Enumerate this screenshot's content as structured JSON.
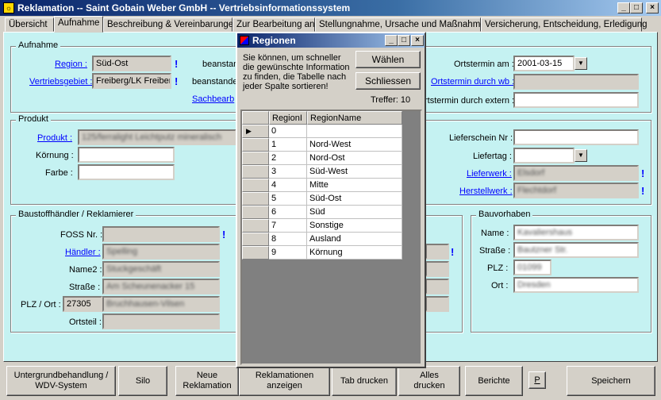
{
  "window": {
    "title": "Reklamation  --  Saint Gobain Weber GmbH -- Vertriebsinformationssystem",
    "icon": "app-icon"
  },
  "tabs": [
    "Übersicht",
    "Aufnahme",
    "Beschreibung & Vereinbarungen",
    "Zur Bearbeitung an",
    "Stellungnahme, Ursache und Maßnahmen",
    "Versicherung, Entscheidung, Erledigung"
  ],
  "aufnahme": {
    "title": "Aufnahme",
    "region_label": "Region :",
    "region_value": "Süd-Ost",
    "vertriebsgebiet_label": "Vertriebsgebiet :",
    "vertriebsgebiet_value": "Freiberg/LK Freiber",
    "beanstandet1_label": "beanstan",
    "beanstandet2_label": "beanstande",
    "sachbearbeiter_label": "Sachbearb",
    "ortstermin_label": "Ortstermin am :",
    "ortstermin_value": "2001-03-15",
    "ortstermin_wb_label": "Ortstermin durch wb :",
    "ortstermin_extern_label": "rtstermin durch extern :"
  },
  "produkt": {
    "title": "Produkt",
    "produkt_label": "Produkt :",
    "produkt_value": "125/ferralight Leichtputz mineralisch",
    "koernung_label": "Körnung :",
    "farbe_label": "Farbe :",
    "lieferschein_label": "Lieferschein Nr :",
    "liefertag_label": "Liefertag :",
    "lieferwerk_label": "Lieferwerk :",
    "lieferwerk_value": "Elsdorf",
    "herstellwerk_label": "Herstellwerk :",
    "herstellwerk_value": "Flechtdorf"
  },
  "baustoff": {
    "title": "Baustoffhändler / Reklamierer",
    "foss_label": "FOSS Nr. :",
    "haendler_label": "Händler :",
    "haendler_value": "Spelling",
    "name2_label": "Name2 :",
    "name2_value": "Stuckgeschäft",
    "strasse_label": "Straße :",
    "strasse_value": "Am Scheunenacker 15",
    "plz_label": "PLZ / Ort :",
    "plz_value": "27305",
    "ort_value": "Bruchhausen-Vilsen",
    "ortsteil_label": "Ortsteil :"
  },
  "bauvorhaben": {
    "title": "Bauvorhaben",
    "name_label": "Name :",
    "name_value": "Kavaliershaus",
    "strasse_label": "Straße :",
    "strasse_value": "Bautzner Str.",
    "plz_label": "PLZ :",
    "plz_value": "01099",
    "ort_label": "Ort :",
    "ort_value": "Dresden"
  },
  "excl": "!",
  "buttons": {
    "untergrund": "Untergrundbehandlung /\nWDV-System",
    "silo": "Silo",
    "neue": "Neue\nReklamation",
    "anzeigen": "Reklamationen\nanzeigen",
    "tab_drucken": "Tab drucken",
    "alles_drucken": "Alles\ndrucken",
    "berichte": "Berichte",
    "p": "P",
    "speichern": "Speichern"
  },
  "dialog": {
    "title": "Regionen",
    "info": "Sie können, um schneller die gewünschte Information zu finden, die Tabelle nach jeder Spalte sortieren!",
    "waehlen": "Wählen",
    "schliessen": "Schliessen",
    "treffer": "Treffer: 10",
    "col1": "RegionI",
    "col2": "RegionName",
    "rows": [
      [
        "0",
        ""
      ],
      [
        "1",
        "Nord-West"
      ],
      [
        "2",
        "Nord-Ost"
      ],
      [
        "3",
        "Süd-West"
      ],
      [
        "4",
        "Mitte"
      ],
      [
        "5",
        "Süd-Ost"
      ],
      [
        "6",
        "Süd"
      ],
      [
        "7",
        "Sonstige"
      ],
      [
        "8",
        "Ausland"
      ],
      [
        "9",
        "Körnung"
      ]
    ]
  }
}
